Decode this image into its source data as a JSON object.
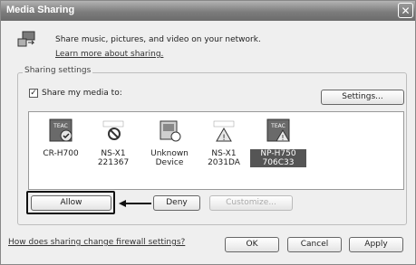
{
  "window": {
    "title": "Media Sharing",
    "close_glyph": "✕"
  },
  "header": {
    "text": "Share music, pictures, and video on your network.",
    "link": "Learn more about sharing."
  },
  "settings": {
    "group_label": "Sharing settings",
    "share_checkbox_checked": true,
    "share_label": "Share my media to:",
    "settings_button": "Settings..."
  },
  "devices": [
    {
      "name_line1": "CR-H700",
      "name_line2": "",
      "icon": "teac-allowed-icon",
      "selected": false
    },
    {
      "name_line1": "NS-X1 221367",
      "name_line2": "",
      "icon": "blocked-icon",
      "selected": false
    },
    {
      "name_line1": "Unknown",
      "name_line2": "Device",
      "icon": "unknown-device-icon",
      "selected": false
    },
    {
      "name_line1": "NS-X1",
      "name_line2": "2031DA",
      "icon": "warning-device-icon",
      "selected": false
    },
    {
      "name_line1": "NP-H750",
      "name_line2": "706C33",
      "icon": "teac-warning-icon",
      "selected": true
    }
  ],
  "actions": {
    "allow": "Allow",
    "deny": "Deny",
    "customize": "Customize..."
  },
  "footer": {
    "link": "How does sharing change firewall settings?",
    "ok": "OK",
    "cancel": "Cancel",
    "apply": "Apply"
  }
}
